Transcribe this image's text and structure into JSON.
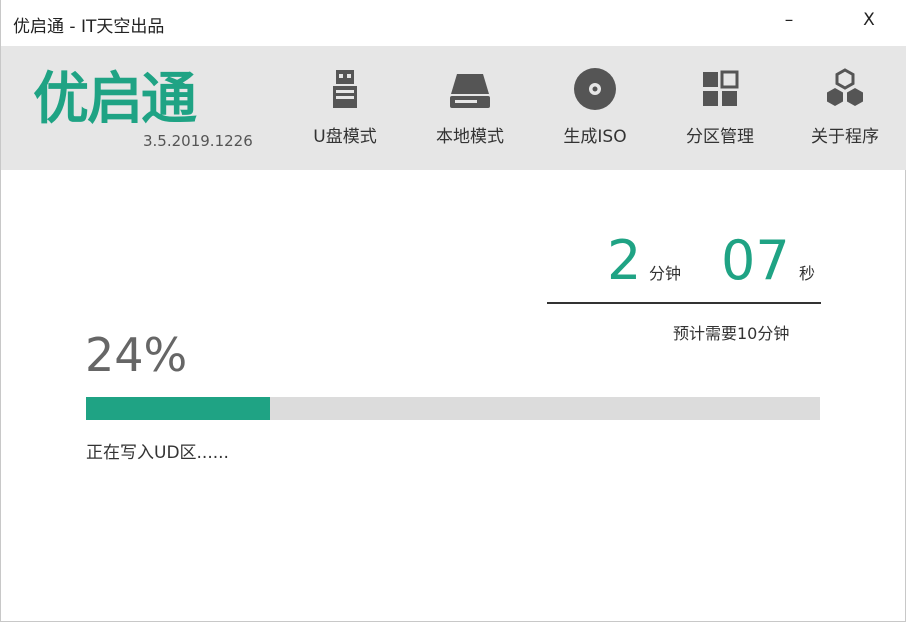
{
  "window": {
    "title": "优启通 - IT天空出品",
    "minimize_label": "–",
    "close_label": "X"
  },
  "header": {
    "logo_text": "优启通",
    "version": "3.5.2019.1226",
    "brand_color": "#1fa384"
  },
  "nav": {
    "items": [
      {
        "label": "U盘模式",
        "icon": "usb-drive-icon"
      },
      {
        "label": "本地模式",
        "icon": "hard-drive-icon"
      },
      {
        "label": "生成ISO",
        "icon": "disc-icon"
      },
      {
        "label": "分区管理",
        "icon": "partition-grid-icon"
      },
      {
        "label": "关于程序",
        "icon": "hexagon-cluster-icon"
      }
    ]
  },
  "timer": {
    "minutes": "2",
    "minutes_unit": "分钟",
    "seconds": "07",
    "seconds_unit": "秒",
    "estimate_text": "预计需要10分钟"
  },
  "progress": {
    "percent_text": "24%",
    "fraction": 0.25,
    "status_text": "正在写入UD区......"
  }
}
